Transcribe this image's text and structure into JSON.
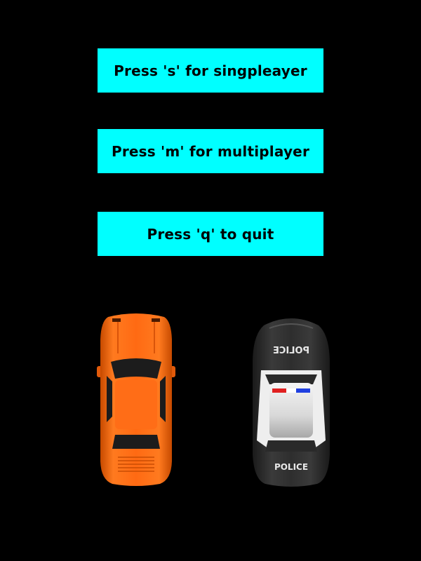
{
  "menu": {
    "single_label": "Press 's' for singpleayer",
    "multi_label": "Press 'm' for multiplayer",
    "quit_label": "Press 'q' to quit"
  },
  "cars": {
    "police_text_top": "POLICE",
    "police_text_bottom": "POLICE"
  },
  "colors": {
    "background": "#000000",
    "button": "#00ffff",
    "button_text": "#000000",
    "orange_car": "#ff6a13",
    "police_dark": "#2f2f2f",
    "police_light": "#e8e8e8"
  }
}
